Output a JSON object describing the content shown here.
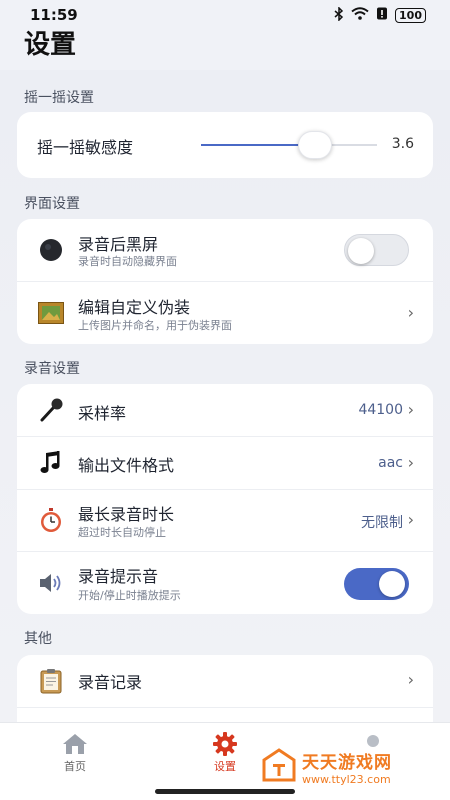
{
  "status": {
    "time": "11:59",
    "battery": "100"
  },
  "page_title": "设置",
  "sections": {
    "shake": {
      "title": "摇一摇设置",
      "sensitivity_label": "摇一摇敏感度",
      "sensitivity_value": "3.6",
      "sensitivity_fraction": 0.65
    },
    "interface": {
      "title": "界面设置",
      "black_screen": {
        "title": "录音后黑屏",
        "subtitle": "录音时自动隐藏界面",
        "enabled": false
      },
      "disguise": {
        "title": "编辑自定义伪装",
        "subtitle": "上传图片并命名，用于伪装界面"
      }
    },
    "recording": {
      "title": "录音设置",
      "sample_rate": {
        "title": "采样率",
        "value": "44100"
      },
      "format": {
        "title": "输出文件格式",
        "value": "aac"
      },
      "max_duration": {
        "title": "最长录音时长",
        "subtitle": "超过时长自动停止",
        "value": "无限制"
      },
      "prompt_sound": {
        "title": "录音提示音",
        "subtitle": "开始/停止时播放提示",
        "enabled": true
      }
    },
    "other": {
      "title": "其他",
      "records": {
        "title": "录音记录"
      }
    }
  },
  "nav": {
    "home": "首页",
    "settings": "设置"
  },
  "watermark": {
    "main": "天天游戏网",
    "sub": "www.ttyl23.com"
  },
  "colors": {
    "accent": "#4a69c6",
    "active_nav": "#d6381f",
    "watermark": "#f07b22"
  }
}
